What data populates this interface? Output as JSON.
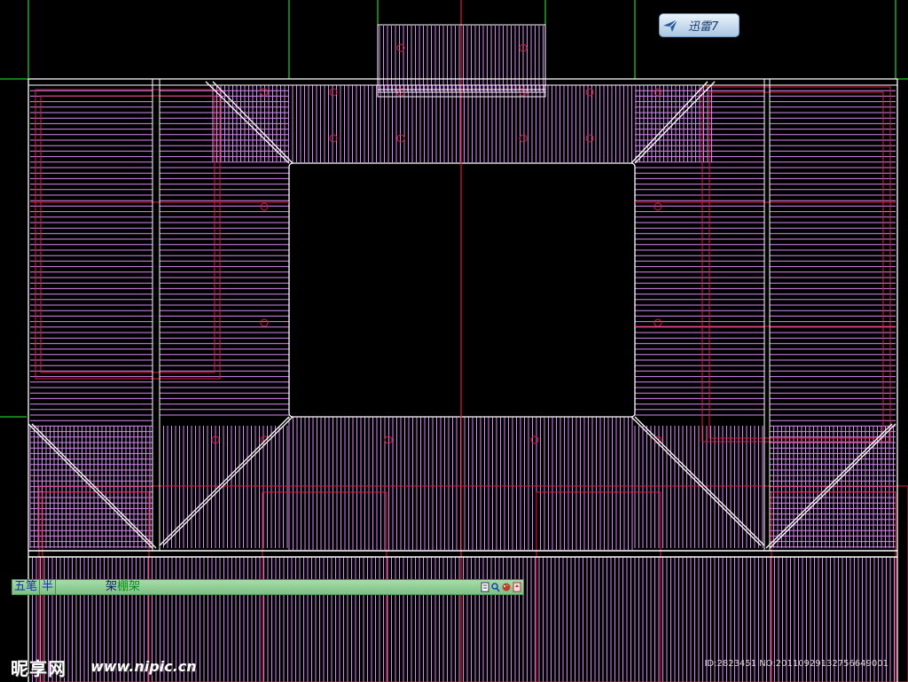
{
  "toolbar_badge": {
    "label": "迅雷7",
    "icon": "bird-icon"
  },
  "ime_bar": {
    "input_method": "五笔",
    "width_mode": "半",
    "candidate_1": "架",
    "candidate_2": "棚架",
    "icons": [
      "document-icon",
      "search-icon",
      "palette-icon",
      "settings-icon"
    ]
  },
  "watermark": {
    "logo": "昵享网",
    "url": "www.nipic.cn",
    "id_text": "ID:2823451 NO:20110929132756649001"
  },
  "colors": {
    "background": "#000000",
    "hatch": "#d48af0",
    "structure": "#ffffff",
    "annotation": "#e0183c",
    "grid": "#22c322"
  }
}
